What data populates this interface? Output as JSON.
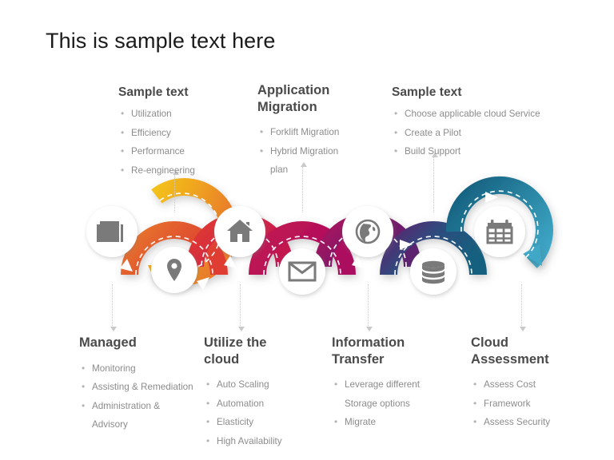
{
  "slide": {
    "title": "This is sample text here",
    "background": "#ffffff"
  },
  "top_blocks": [
    {
      "id": "top-1",
      "heading": "Sample text",
      "items": [
        "Utilization",
        "Efficiency",
        "Performance",
        "Re-engineering"
      ]
    },
    {
      "id": "top-2",
      "heading": "Application Migration",
      "items": [
        "Forklift Migration",
        "Hybrid Migration",
        "plan"
      ]
    },
    {
      "id": "top-3",
      "heading": "Sample text",
      "items": [
        "Choose applicable cloud Service",
        "Create a Pilot",
        "Build Support"
      ]
    }
  ],
  "bottom_blocks": [
    {
      "id": "bottom-1",
      "heading": "Managed",
      "items": [
        "Monitoring",
        "Assisting & Remediation",
        "Administration &",
        "Advisory"
      ]
    },
    {
      "id": "bottom-2",
      "heading": "Utilize the cloud",
      "items": [
        "Auto Scaling",
        "Automation",
        "Elasticity",
        "High Availability"
      ]
    },
    {
      "id": "bottom-3",
      "heading": "Information Transfer",
      "items": [
        "Leverage different",
        "Storage options",
        "Migrate"
      ]
    },
    {
      "id": "bottom-4",
      "heading": "Cloud Assessment",
      "items": [
        "Assess Cost",
        "Framework",
        "Assess Security"
      ]
    }
  ],
  "nodes": [
    {
      "id": "node-1",
      "icon": "newspaper-icon",
      "position": "top"
    },
    {
      "id": "node-2",
      "icon": "location-pin-icon",
      "position": "bottom"
    },
    {
      "id": "node-3",
      "icon": "home-icon",
      "position": "top"
    },
    {
      "id": "node-4",
      "icon": "envelope-icon",
      "position": "bottom"
    },
    {
      "id": "node-5",
      "icon": "globe-icon",
      "position": "top"
    },
    {
      "id": "node-6",
      "icon": "database-icon",
      "position": "bottom"
    },
    {
      "id": "node-7",
      "icon": "calendar-icon",
      "position": "top"
    }
  ],
  "ribbon_colors": {
    "yellow": "#F5BE18",
    "orange": "#E8792B",
    "red": "#E03C31",
    "crimson": "#C3174F",
    "magenta": "#AB0F5E",
    "purple": "#5B2470",
    "teal_dark": "#15607F",
    "teal_light": "#3FA7C7",
    "icon_gray": "#7A7A7A",
    "text_gray": "#8C8C8C",
    "heading_gray": "#4A4A4A",
    "connector_gray": "#C9C9C9"
  }
}
